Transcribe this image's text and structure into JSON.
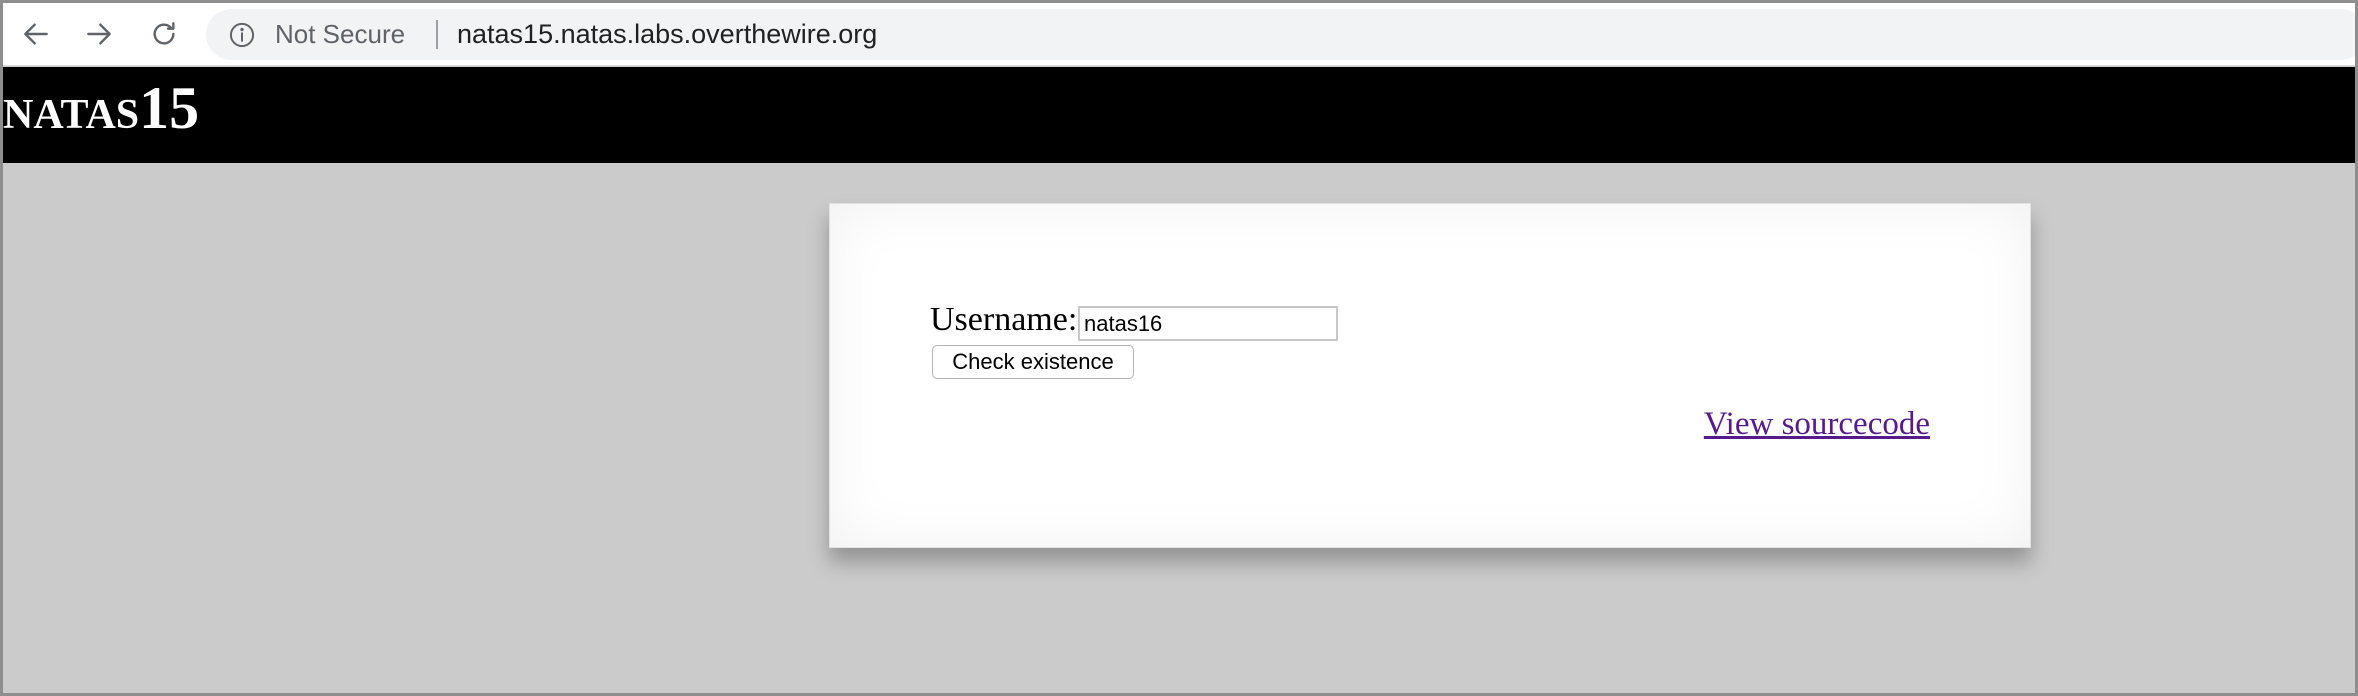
{
  "browser": {
    "nav": {
      "back_icon": "arrow-left-icon",
      "forward_icon": "arrow-right-icon",
      "reload_icon": "reload-icon"
    },
    "address_bar": {
      "security_icon": "info-icon",
      "security_text": "Not Secure",
      "url": "natas15.natas.labs.overthewire.org"
    }
  },
  "header": {
    "title": "natas15",
    "background_color": "#000000",
    "text_color": "#ffffff"
  },
  "form": {
    "username_label": "Username:",
    "username_value": "natas16",
    "submit_label": "Check existence"
  },
  "links": {
    "view_source": "View sourcecode",
    "link_color": "#551a8b"
  },
  "colors": {
    "page_background": "#cbcbcb",
    "card_background": "#ffffff"
  }
}
